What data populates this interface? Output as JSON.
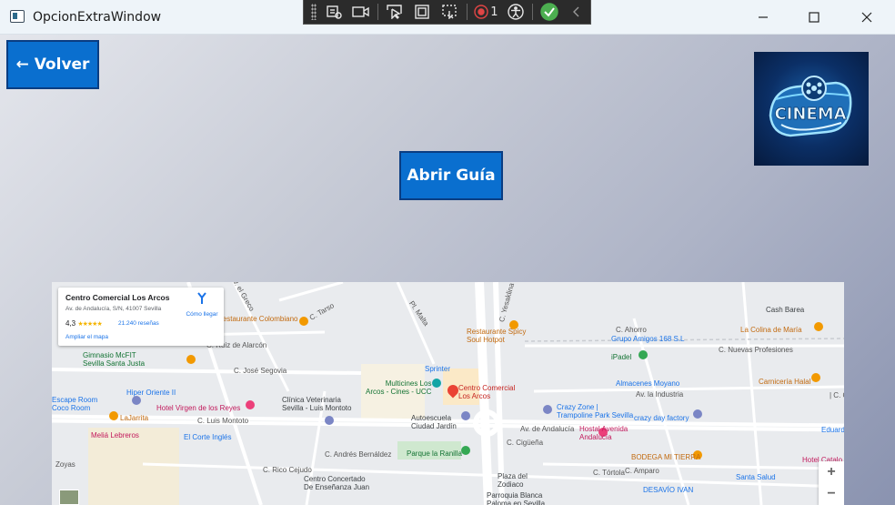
{
  "window": {
    "title": "OpcionExtraWindow"
  },
  "debug_toolbar": {
    "count": "1"
  },
  "buttons": {
    "volver": "← Volver",
    "abrir_guia": "Abrir Guía"
  },
  "logo": {
    "text": "CINEMA"
  },
  "map": {
    "info_card": {
      "title": "Centro Comercial Los Arcos",
      "address": "Av. de Andalucía, S/N, 41007 Sevilla",
      "rating": "4,3",
      "stars": "★★★★★",
      "reviews": "21.240 reseñas",
      "enlarge": "Ampliar el mapa",
      "directions": "Cómo llegar"
    },
    "zoom_in": "+",
    "zoom_out": "−",
    "labels": {
      "av_greco": "Av. el Greco",
      "restaurante_colombiano": "Restaurante Colombiano",
      "c_tarso": "C. Tarso",
      "pl_malta": "Pl. Malta",
      "c_yesaklina": "C. Yesaklina",
      "cash_barea": "Cash Barea",
      "c_ahorro": "C. Ahorro",
      "restaurante_spicy": "Restaurante Spicy\nSoul Hotpot",
      "grupo_amigos": "Grupo Amigos 168 S.L",
      "la_colina": "La Colina de María",
      "c_nuevas_profesiones": "C. Nuevas Profesiones",
      "c_ruiz_alarcon": "C. Ruiz de Alarcón",
      "gimnasio": "Gimnasio McFIT\nSevilla Santa Justa",
      "c_jose_segovia": "C. José Segovia",
      "sprinter": "Sprinter",
      "ipadel": "iPadel",
      "almacenes_moyano": "Almacenes Moyano",
      "av_industria": "Av. la Industria",
      "carniceria_halal": "Carnicería Halal",
      "c_corre": "| C. Corre",
      "hiper_oriente": "Hiper Oriente II",
      "multicines": "Multicines Los\nArcos - Cines - UCC",
      "centro_comercial": "Centro Comercial\nLos Arcos",
      "crazy_zone": "Crazy Zone |\nTrampoline Park Sevilla",
      "escape_room": "Escape Room\nCoco Room",
      "hotel_virgen": "Hotel Virgen de los Reyes",
      "clinica_veterinaria": "Clínica Veterinaria\nSevilla - Luis Montoto",
      "crazy_day": "crazy day factory",
      "la_jarrita": "LaJarrita",
      "c_luis_montoto": "C. Luis Montoto",
      "autoescuela": "Autoescuela\nCiudad Jardín",
      "av_andalucia": "Av. de Andalucía",
      "hostal_avenida": "Hostal Avenida\nAndalucía",
      "edward": "Eduard",
      "melia": "Meliá Lebreros",
      "el_corte_ingles": "El Corte Inglés",
      "c_cigüeña": "C. Cigüeña",
      "bodega": "BODEGA MI TIERRA",
      "hotel_catalo": "Hotel Catalo",
      "c_andres_bernaldez": "C. Andrés Bernáldez",
      "parque_ranilla": "Parque la Ranilla",
      "c_tortola": "C. Tórtola",
      "zoyas": "Zoyas",
      "c_rico_cejudo": "C. Rico Cejudo",
      "plaza_zodiaco": "Plaza del\nZodiaco",
      "c_amparo": "C. Amparo",
      "santa_salud": "Santa Salud",
      "centro_concertado": "Centro Concertado\nDe Enseñanza Juan",
      "parroquia": "Parroquia Blanca\nPaloma en Sevilla",
      "desavio": "DESAVÍO IVAN"
    }
  }
}
